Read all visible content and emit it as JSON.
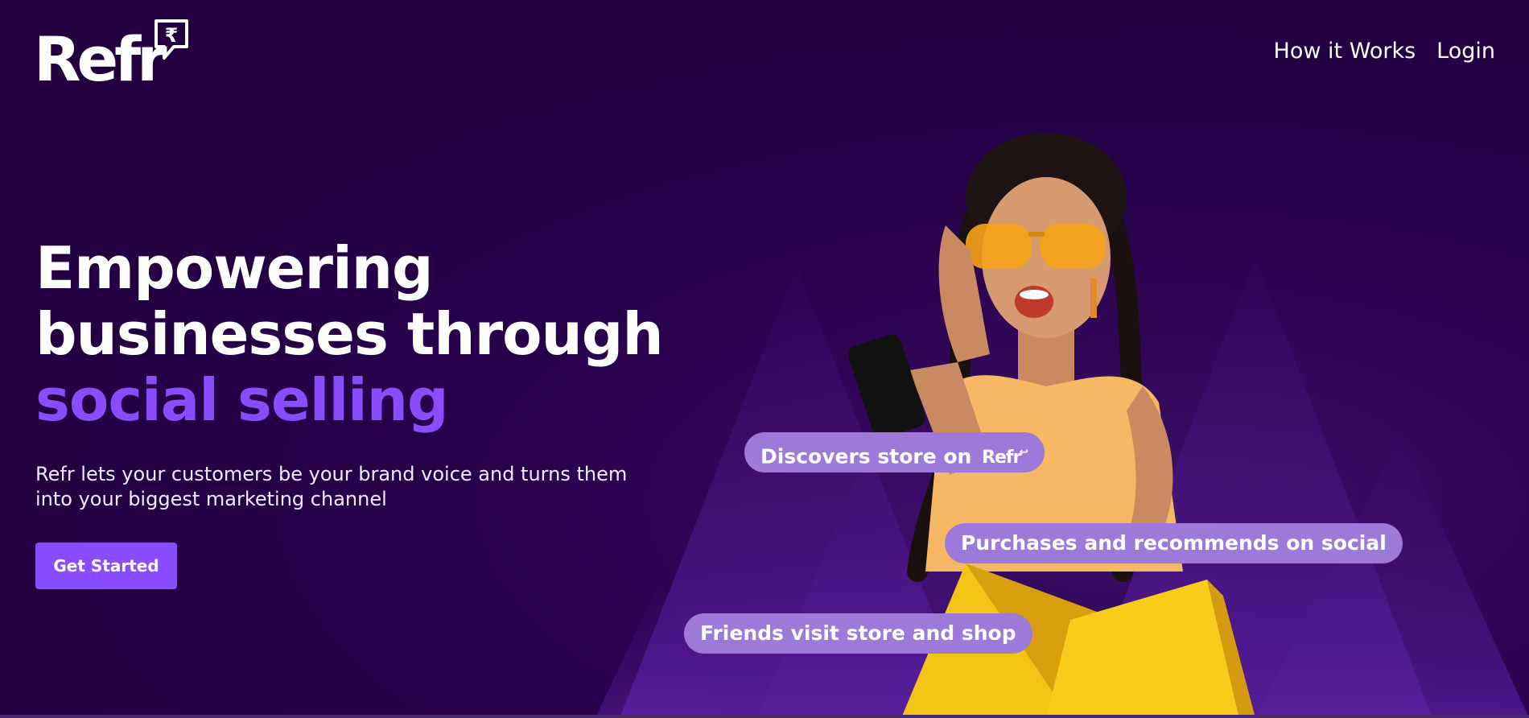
{
  "brand": {
    "logo_text": "Refr",
    "logo_mark": "₹",
    "accent_color": "#8a4cff",
    "background_color": "#22003f"
  },
  "nav": {
    "items": [
      {
        "label": "How it Works"
      },
      {
        "label": "Login"
      }
    ]
  },
  "hero": {
    "title_line1": "Empowering",
    "title_line2": "businesses through",
    "title_accent": "social selling",
    "description": "Refr lets your customers be your brand voice and turns them into your biggest marketing channel",
    "cta_label": "Get Started"
  },
  "bubbles": {
    "discover_text": "Discovers store on",
    "discover_logo": "Refr",
    "purchase_text": "Purchases and recommends on social",
    "friends_text": "Friends visit store and shop"
  }
}
